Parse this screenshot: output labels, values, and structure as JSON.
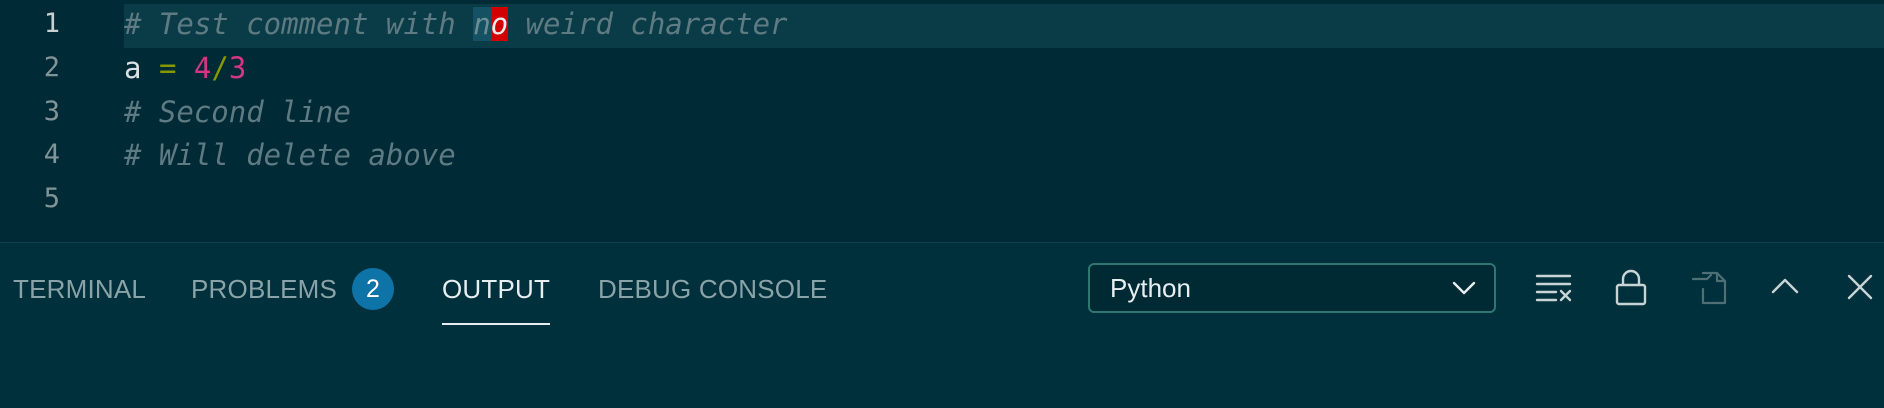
{
  "editor": {
    "line_numbers": [
      "1",
      "2",
      "3",
      "4",
      "5"
    ],
    "line1": {
      "before": "# Test comment with ",
      "highlight": "n",
      "cursor_char": "o",
      "after": " weird character"
    },
    "line2": {
      "id": "a",
      "op": "=",
      "num1": "4",
      "slash": "/",
      "num2": "3"
    },
    "line3": "# Second line",
    "line4": "# Will delete above",
    "line5": ""
  },
  "panel": {
    "tabs": {
      "terminal": "TERMINAL",
      "problems": "PROBLEMS",
      "problems_count": "2",
      "output": "OUTPUT",
      "debug_console": "DEBUG CONSOLE"
    },
    "active_tab": "OUTPUT",
    "output_channel": "Python",
    "actions": {
      "clear": "clear-output-icon",
      "lock": "lock-icon",
      "open_editor": "open-in-editor-icon",
      "maximize": "chevron-up-icon",
      "close": "close-icon"
    }
  },
  "colors": {
    "background": "#002b36",
    "current_line": "#073642",
    "badge": "#0e74a8",
    "cursor": "#d30102",
    "number": "#d33682",
    "operator": "#859900"
  }
}
